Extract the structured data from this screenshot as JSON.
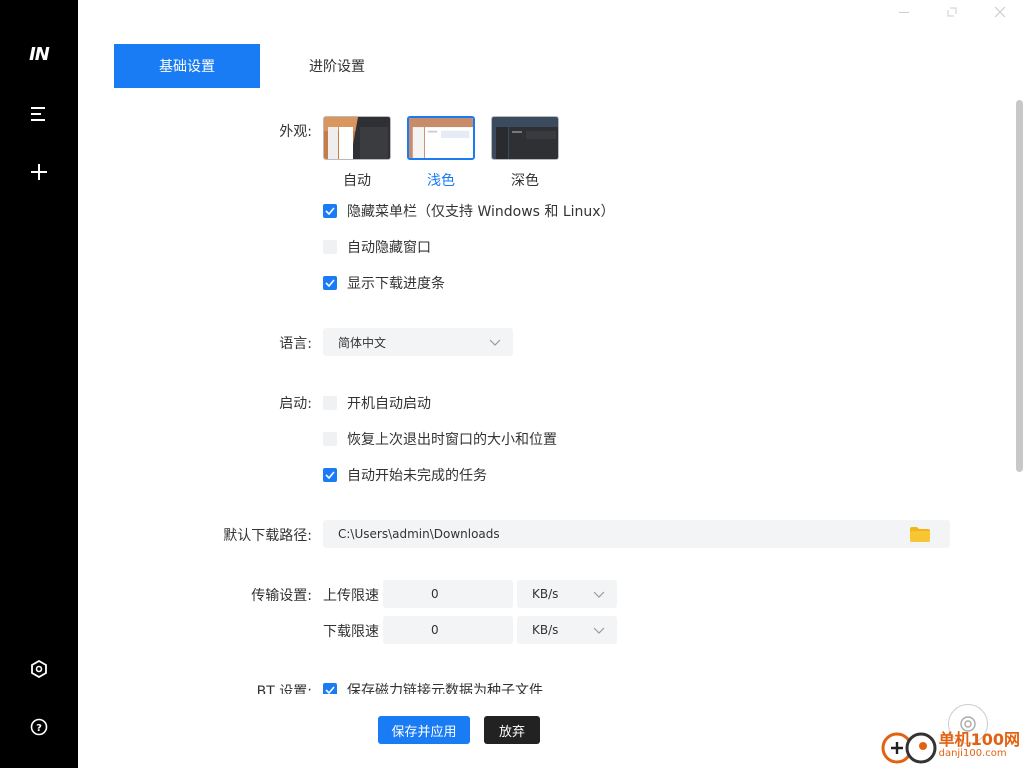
{
  "sidebar": {
    "logo": "IN"
  },
  "tabs": {
    "basic": "基础设置",
    "advanced": "进阶设置"
  },
  "appearance": {
    "label": "外观:",
    "options": [
      "自动",
      "浅色",
      "深色"
    ],
    "selected": "浅色"
  },
  "checkboxes": {
    "hide_menu": {
      "text": "隐藏菜单栏（仅支持 Windows 和 Linux）",
      "checked": true
    },
    "auto_hide": {
      "text": "自动隐藏窗口",
      "checked": false
    },
    "show_progress": {
      "text": "显示下载进度条",
      "checked": true
    }
  },
  "language": {
    "label": "语言:",
    "value": "简体中文"
  },
  "startup": {
    "label": "启动:",
    "boot": {
      "text": "开机自动启动",
      "checked": false
    },
    "restore": {
      "text": "恢复上次退出时窗口的大小和位置",
      "checked": false
    },
    "resume": {
      "text": "自动开始未完成的任务",
      "checked": true
    }
  },
  "download_path": {
    "label": "默认下载路径:",
    "value": "C:\\Users\\admin\\Downloads"
  },
  "transfer": {
    "label": "传输设置:",
    "upload": {
      "label": "上传限速",
      "value": "0",
      "unit": "KB/s"
    },
    "download": {
      "label": "下载限速",
      "value": "0",
      "unit": "KB/s"
    }
  },
  "bt": {
    "label": "BT 设置:",
    "text": "保存磁力链接元数据为种子文件",
    "checked": true
  },
  "buttons": {
    "save": "保存并应用",
    "discard": "放弃"
  },
  "watermark": {
    "line1": "单机100网",
    "line2": "danji100.com"
  },
  "colors": {
    "accent": "#1a7cf5",
    "sidebar": "#000000"
  }
}
